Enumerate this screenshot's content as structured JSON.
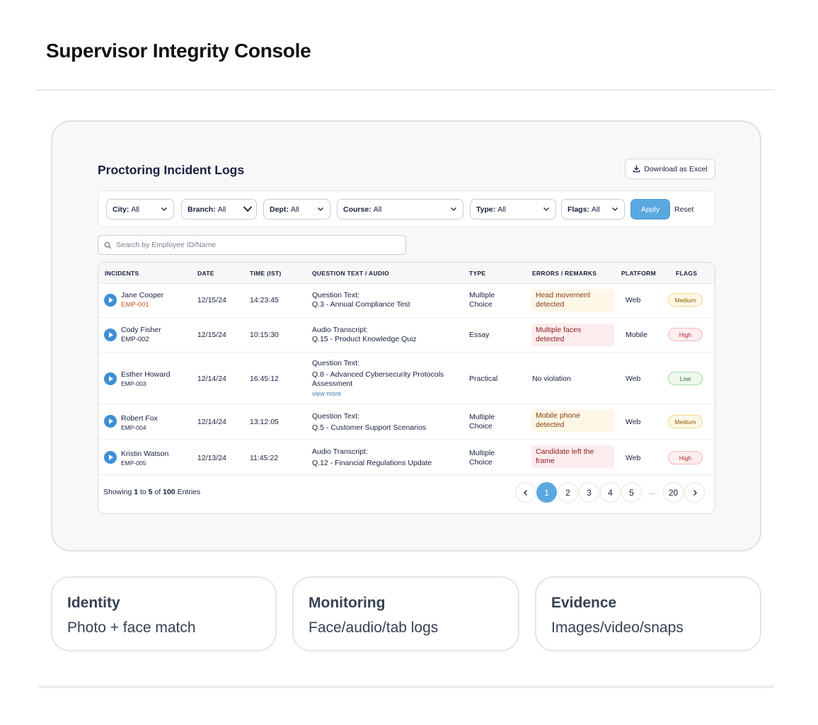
{
  "page": {
    "title": "Supervisor Integrity Console"
  },
  "card": {
    "title": "Proctoring Incident Logs",
    "download_label": "Download as Excel"
  },
  "filters": [
    {
      "key": "City:",
      "value": "All"
    },
    {
      "key": "Branch:",
      "value": "All"
    },
    {
      "key": "Dept:",
      "value": "All"
    },
    {
      "key": "Course:",
      "value": "All"
    },
    {
      "key": "Type:",
      "value": "All"
    },
    {
      "key": "Flags:",
      "value": "All"
    }
  ],
  "actions": {
    "apply": "Apply",
    "reset": "Reset"
  },
  "search": {
    "placeholder": "Search by Employee ID/Name",
    "value": ""
  },
  "table": {
    "headers": [
      "INCIDENTS",
      "DATE",
      "TIME (IST)",
      "QUESTION TEXT / AUDIO",
      "TYPE",
      "ERRORS / REMARKS",
      "PLATFORM",
      "FLAGS"
    ],
    "rows": [
      {
        "name": "Jane Cooper",
        "emp": "EMP-001",
        "date": "12/15/24",
        "time": "14:23:45",
        "q_label": "Question Text:",
        "q_text": "Q.3 - Annual Compliance Test",
        "type_line1": "Multiple",
        "type_line2": "Choice",
        "remark_line1": "Head movement",
        "remark_line2": "detected",
        "platform": "Web",
        "flag": "Medium"
      },
      {
        "name": "Cody Fisher",
        "emp": "EMP-002",
        "date": "12/15/24",
        "time": "10:15:30",
        "q_label": "Audio Transcript:",
        "q_text": "Q.15 - Product Knowledge Quiz",
        "type_line1": "Essay",
        "type_line2": "",
        "remark_line1": "Multiple faces",
        "remark_line2": "detected",
        "platform": "Mobile",
        "flag": "High"
      },
      {
        "name": "Esther Howard",
        "emp": "EMP-003",
        "date": "12/14/24",
        "time": "16:45:12",
        "q_label": "Question Text:",
        "q_text": "Q.8 - Advanced Cybersecurity Protocols",
        "q_text2": "Assessment",
        "view_more": "view more",
        "type_line1": "Practical",
        "type_line2": "",
        "remark_line1": "No violation",
        "remark_line2": "",
        "platform": "Web",
        "flag": "Low"
      },
      {
        "name": "Robert Fox",
        "emp": "EMP-004",
        "date": "12/14/24",
        "time": "13:12:05",
        "q_label": "Question Text:",
        "q_text": "Q.5 - Customer Support Scenarios",
        "type_line1": "Multiple",
        "type_line2": "Choice",
        "remark_line1": "Mobile phone",
        "remark_line2": "detected",
        "platform": "Web",
        "flag": "Medium"
      },
      {
        "name": "Kristin Watson",
        "emp": "EMP-005",
        "date": "12/13/24",
        "time": "11:45:22",
        "q_label": "Audio Transcript:",
        "q_text": "Q.12 - Financial Regulations Update",
        "type_line1": "Multiple",
        "type_line2": "Choice",
        "remark_line1": "Candidate left the",
        "remark_line2": "frame",
        "platform": "Web",
        "flag": "High"
      }
    ]
  },
  "footer": {
    "showing": "Showing",
    "from": "1",
    "to_word": "to",
    "to": "5",
    "of_word": "of",
    "total": "100",
    "entries": "Entries"
  },
  "pagination": {
    "prev": "‹",
    "pages": [
      "1",
      "2",
      "3",
      "4",
      "5"
    ],
    "ellipsis": "...",
    "last": "20",
    "next": "›",
    "current": "1"
  },
  "features": [
    {
      "title": "Identity",
      "subtitle": "Photo + face match"
    },
    {
      "title": "Monitoring",
      "subtitle": "Face/audio/tab logs"
    },
    {
      "title": "Evidence",
      "subtitle": "Images/video/snaps"
    }
  ],
  "colors": {
    "accent": "#5aa8e0",
    "play": "#3d8fd6",
    "emp_highlight": "#c8561c"
  }
}
